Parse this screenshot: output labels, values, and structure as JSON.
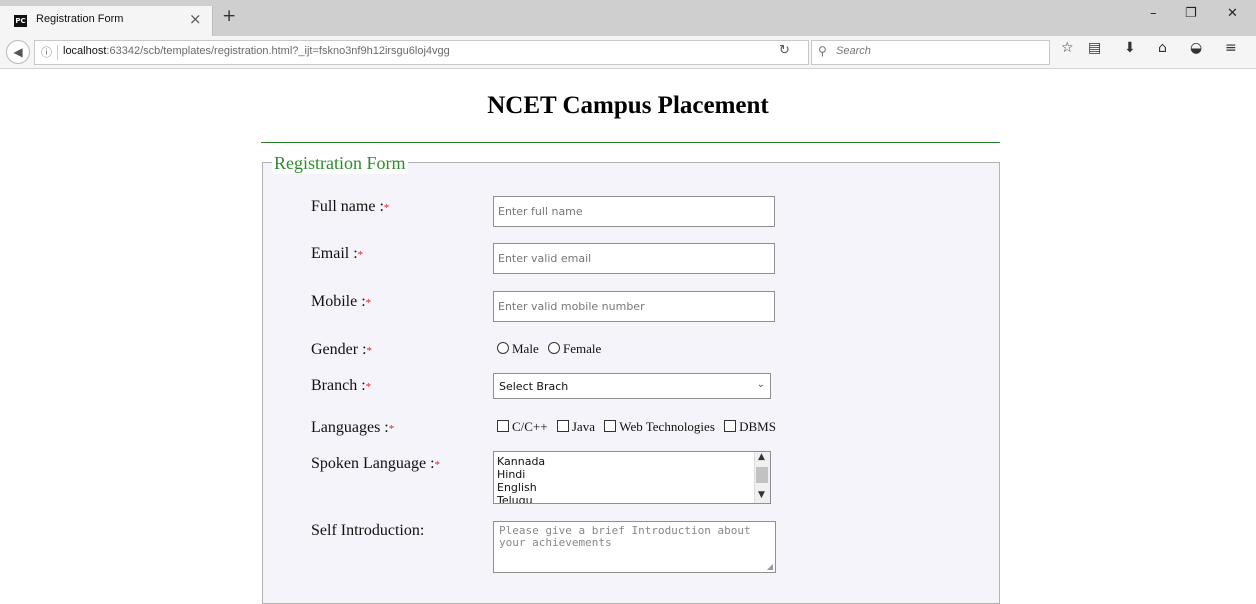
{
  "browser": {
    "tab_title": "Registration Form",
    "tab_icon_text": "PC",
    "url_host": "localhost",
    "url_rest": ":63342/scb/templates/registration.html?_ijt=fskno3nf9h12irsgu6loj4vgg",
    "search_placeholder": "Search"
  },
  "page": {
    "title": "NCET Campus Placement",
    "legend": "Registration Form"
  },
  "form": {
    "required_mark": "*",
    "full_name": {
      "label": "Full name :",
      "placeholder": "Enter full name"
    },
    "email": {
      "label": "Email :",
      "placeholder": "Enter valid email"
    },
    "mobile": {
      "label": "Mobile :",
      "placeholder": "Enter valid mobile number"
    },
    "gender": {
      "label": "Gender :",
      "options": [
        "Male",
        "Female"
      ]
    },
    "branch": {
      "label": "Branch :",
      "selected": "Select Brach"
    },
    "languages": {
      "label": "Languages :",
      "options": [
        "C/C++",
        "Java",
        "Web Technologies",
        "DBMS"
      ]
    },
    "spoken": {
      "label": "Spoken Language :",
      "options": [
        "Kannada",
        "Hindi",
        "English",
        "Telugu"
      ]
    },
    "intro": {
      "label": "Self Introduction:",
      "placeholder": "Please give a brief Introduction about your achievements"
    }
  }
}
